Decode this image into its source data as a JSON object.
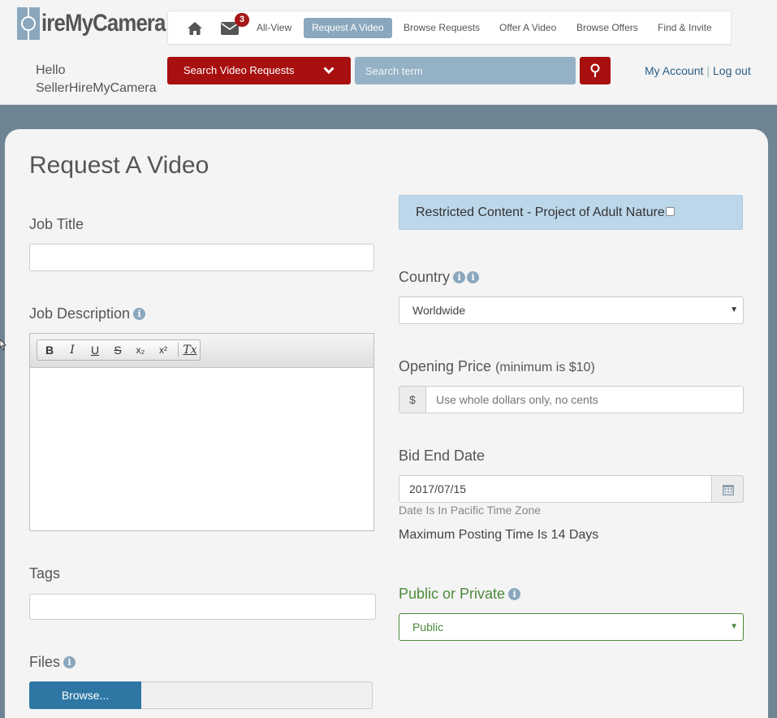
{
  "brand": {
    "logo_text": "ireMyCamera"
  },
  "nav": {
    "mail_count": "3",
    "links": [
      "All-View",
      "Request A Video",
      "Browse Requests",
      "Offer A Video",
      "Browse Offers",
      "Find & Invite"
    ],
    "active_link": "Request A Video"
  },
  "greeting": {
    "line1": "Hello",
    "line2": "SellerHireMyCamera"
  },
  "search": {
    "type_label": "Search Video Requests",
    "placeholder": "Search term"
  },
  "account": {
    "my_account": "My Account",
    "logout": "Log out"
  },
  "form": {
    "title": "Request A Video",
    "job_title_label": "Job Title",
    "job_title_value": "",
    "job_description_label": "Job Description",
    "editor_tools": [
      "B",
      "I",
      "U",
      "S",
      "x₂",
      "x²",
      "Tx"
    ],
    "tags_label": "Tags",
    "tags_value": "",
    "files_label": "Files",
    "browse_label": "Browse...",
    "restricted_label": "Restricted Content - Project of Adult Nature",
    "restricted_checked": false,
    "country_label": "Country",
    "country_value": "Worldwide",
    "price_label": "Opening Price",
    "price_hint": "(minimum is $10)",
    "currency_symbol": "$",
    "price_placeholder": "Use whole dollars only, no cents",
    "bid_end_label": "Bid End Date",
    "bid_end_value": "2017/07/15",
    "timezone_note": "Date Is In Pacific Time Zone",
    "max_posting_note": "Maximum Posting Time Is 14 Days",
    "visibility_label": "Public or Private",
    "visibility_value": "Public"
  },
  "colors": {
    "brand_red": "#a80f0f",
    "steel_blue": "#8aa7bd",
    "band": "#6f8593",
    "restricted_bg": "#bcd6ea",
    "green": "#4d8a3a",
    "browse_blue": "#2e77a5"
  }
}
